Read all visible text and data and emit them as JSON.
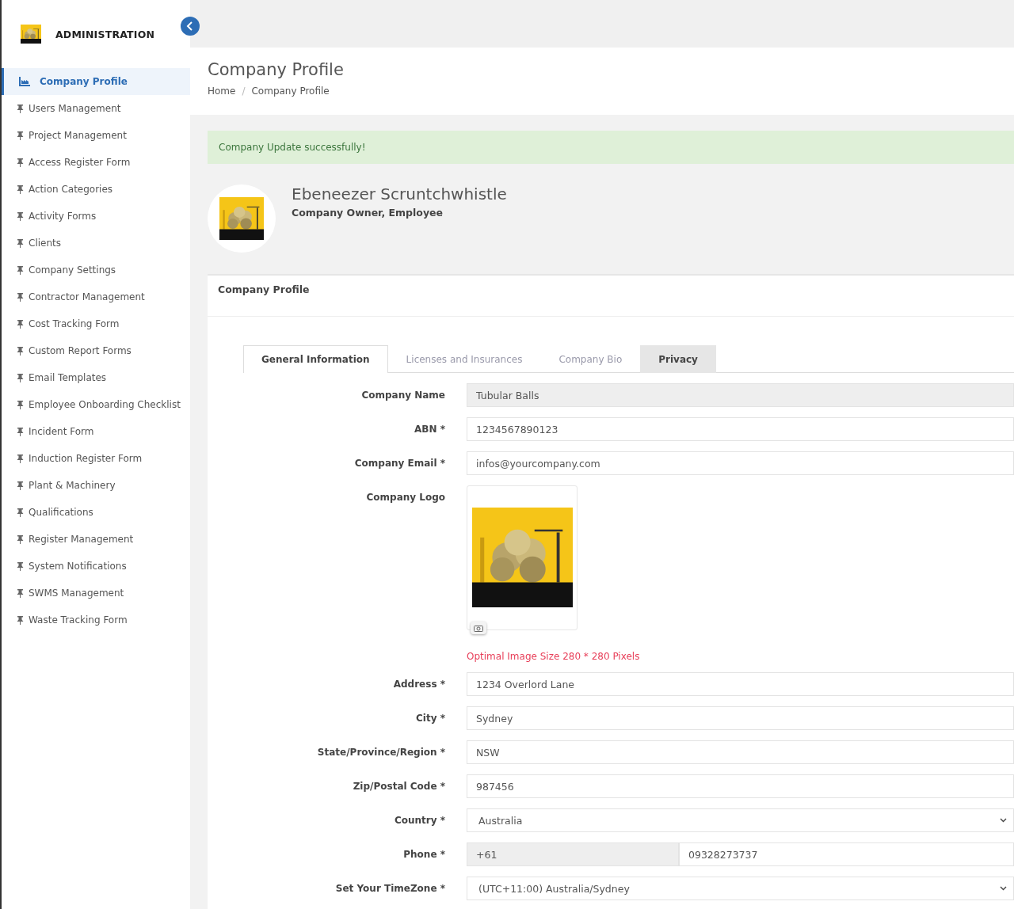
{
  "sidebar": {
    "title": "ADMINISTRATION",
    "items": [
      {
        "label": "Company Profile",
        "selected": true
      },
      {
        "label": "Users Management",
        "selected": false
      },
      {
        "label": "Project Management",
        "selected": false
      },
      {
        "label": "Access Register Form",
        "selected": false
      },
      {
        "label": "Action Categories",
        "selected": false
      },
      {
        "label": "Activity Forms",
        "selected": false
      },
      {
        "label": "Clients",
        "selected": false
      },
      {
        "label": "Company Settings",
        "selected": false
      },
      {
        "label": "Contractor Management",
        "selected": false
      },
      {
        "label": "Cost Tracking Form",
        "selected": false
      },
      {
        "label": "Custom Report Forms",
        "selected": false
      },
      {
        "label": "Email Templates",
        "selected": false
      },
      {
        "label": "Employee Onboarding Checklist",
        "selected": false
      },
      {
        "label": "Incident Form",
        "selected": false
      },
      {
        "label": "Induction Register Form",
        "selected": false
      },
      {
        "label": "Plant & Machinery",
        "selected": false
      },
      {
        "label": "Qualifications",
        "selected": false
      },
      {
        "label": "Register Management",
        "selected": false
      },
      {
        "label": "System Notifications",
        "selected": false
      },
      {
        "label": "SWMS Management",
        "selected": false
      },
      {
        "label": "Waste Tracking Form",
        "selected": false
      }
    ]
  },
  "header": {
    "title": "Company Profile",
    "breadcrumb": [
      "Home",
      "Company Profile"
    ],
    "separator": "/"
  },
  "alert": "Company Update successfully!",
  "profile": {
    "name": "Ebeneezer Scruntchwhistle",
    "roles": "Company Owner, Employee"
  },
  "card": {
    "title": "Company Profile",
    "tabs": [
      {
        "label": "General Information",
        "selected": true,
        "highlighted": false
      },
      {
        "label": "Licenses and Insurances",
        "selected": false,
        "highlighted": false
      },
      {
        "label": "Company Bio",
        "selected": false,
        "highlighted": false
      },
      {
        "label": "Privacy",
        "selected": false,
        "highlighted": true
      }
    ],
    "fields": [
      {
        "kind": "text",
        "label": "Company Name",
        "value": "Tubular Balls",
        "disabled": true
      },
      {
        "kind": "text",
        "label": "ABN *",
        "value": "1234567890123",
        "disabled": false
      },
      {
        "kind": "text",
        "label": "Company Email *",
        "value": "infos@yourcompany.com",
        "disabled": false
      },
      {
        "kind": "logo",
        "label": "Company Logo",
        "hint": "Optimal Image Size 280 * 280 Pixels"
      },
      {
        "kind": "text",
        "label": "Address *",
        "value": "1234 Overlord Lane",
        "disabled": false
      },
      {
        "kind": "text",
        "label": "City *",
        "value": "Sydney",
        "disabled": false
      },
      {
        "kind": "text",
        "label": "State/Province/Region *",
        "value": "NSW",
        "disabled": false
      },
      {
        "kind": "text",
        "label": "Zip/Postal Code *",
        "value": "987456",
        "disabled": false
      },
      {
        "kind": "select",
        "label": "Country *",
        "value": "Australia"
      },
      {
        "kind": "phone",
        "label": "Phone *",
        "code": "+61",
        "value": "09328273737"
      },
      {
        "kind": "select",
        "label": "Set Your TimeZone *",
        "value": "(UTC+11:00) Australia/Sydney"
      }
    ]
  }
}
